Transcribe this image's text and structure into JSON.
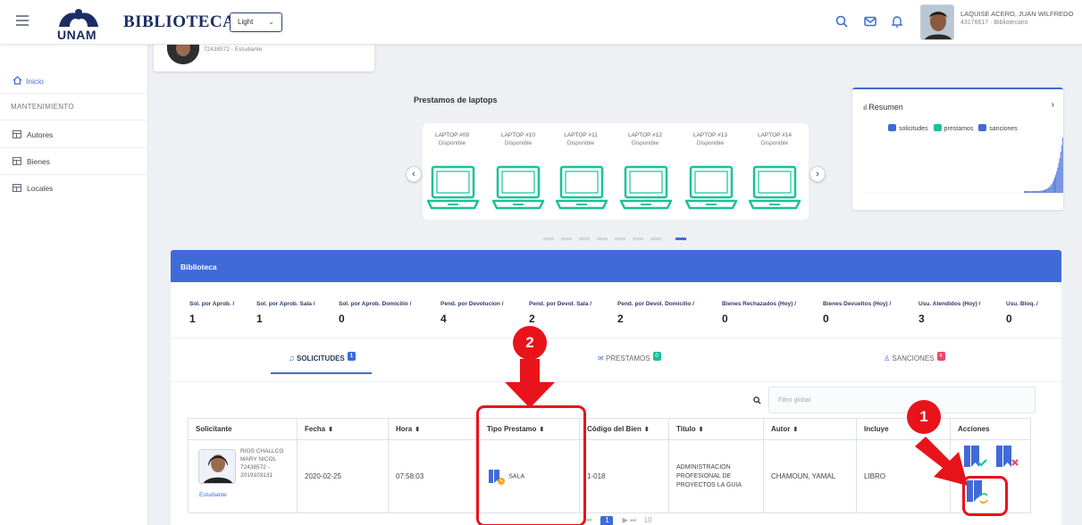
{
  "header": {
    "brand_logo_text": "UNAM",
    "brand_title": "BIBLIOTECA",
    "theme_value": "Light",
    "user_name": "LAQUISE ACERO, JUAN WILFREDO",
    "user_role": "43176617 · Bibliotecario"
  },
  "sidebar": {
    "items": [
      {
        "label": "Inicio",
        "icon": "home-icon",
        "active": true
      },
      {
        "label": "Autores",
        "icon": "table-icon"
      },
      {
        "label": "Bienes",
        "icon": "table-icon"
      },
      {
        "label": "Locales",
        "icon": "table-icon"
      }
    ],
    "section_heading": "MANTENIMIENTO"
  },
  "profile": {
    "subtitle": "72438572 - Estudiante"
  },
  "laptops": {
    "title": "Prestamos de laptops",
    "items": [
      {
        "name": "LAPTOP #09",
        "status": "Disponible"
      },
      {
        "name": "LAPTOP #10",
        "status": "Disponible"
      },
      {
        "name": "LAPTOP #11",
        "status": "Disponible"
      },
      {
        "name": "LAPTOP #12",
        "status": "Disponible"
      },
      {
        "name": "LAPTOP #13",
        "status": "Disponible"
      },
      {
        "name": "LAPTOP #14",
        "status": "Disponible"
      }
    ],
    "carousel_pages": 8,
    "carousel_active_page": 8,
    "accent_color": "#19c29a"
  },
  "resumen": {
    "title": "Resumen",
    "legend": [
      "solicitudes",
      "prestamos",
      "sanciones"
    ],
    "legend_colors": [
      "#3f6ad8",
      "#19c29a",
      "#3f6ad8"
    ]
  },
  "biblioteca": {
    "title": "Biblioteca",
    "stats": [
      {
        "label": "Sol. por Aprob. /",
        "value": "1"
      },
      {
        "label": "Sol. por Aprob. Sala /",
        "value": "1"
      },
      {
        "label": "Sol. por Aprob. Domicilio /",
        "value": "0"
      },
      {
        "label": "Pend. por Devolucion /",
        "value": "4"
      },
      {
        "label": "Pend. por Devol. Sala /",
        "value": "2"
      },
      {
        "label": "Pend. por Devol. Domicilio /",
        "value": "2"
      },
      {
        "label": "Bienes Rechazados (Hoy) /",
        "value": "0"
      },
      {
        "label": "Bienes Devueltos (Hoy) /",
        "value": "0"
      },
      {
        "label": "Usu. Atendidos (Hoy) /",
        "value": "3"
      },
      {
        "label": "Usu. Bloq. /",
        "value": "0"
      }
    ],
    "tabs": [
      {
        "label": "SOLICITUDES",
        "badge": "1",
        "badge_color": "#3f6ad8"
      },
      {
        "label": "PRESTAMOS",
        "badge": "0",
        "badge_color": "#19c29a"
      },
      {
        "label": "SANCIONES",
        "badge": "4",
        "badge_color": "#e84a6c"
      }
    ],
    "filter_placeholder": "Filtro global"
  },
  "table": {
    "columns": [
      "Solicitante",
      "Fecha",
      "Hora",
      "Tipo Prestamo",
      "Código del Bien",
      "Titulo",
      "Autor",
      "Incluye",
      "Acciones"
    ],
    "row": {
      "solicitante_name_1": "RIOS CHALLCO",
      "solicitante_name_2": "MARY NICOL",
      "solicitante_code_1": "72438572 -",
      "solicitante_code_2": "2019103131",
      "solicitante_role": "Estudiante",
      "fecha": "2020-02-25",
      "hora": "07:58:03",
      "tipo": "SALA",
      "codigo": "1-018",
      "titulo_1": "ADMINISTRACION",
      "titulo_2": "PROFESIONAL DE",
      "titulo_3": "PROYECTOS LA GUIA",
      "autor": "CHAMOUN, YAMAL",
      "incluye": "LIBRO"
    },
    "pager_text": "10"
  },
  "annotations": {
    "step_1": "1",
    "step_2": "2",
    "color": "#e8131b"
  }
}
